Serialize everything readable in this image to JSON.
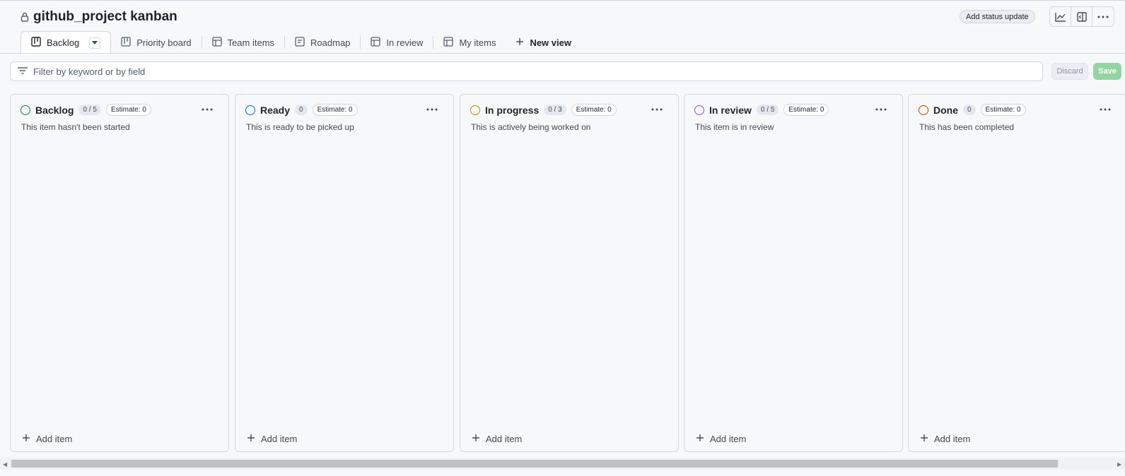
{
  "project": {
    "title": "github_project kanban"
  },
  "header": {
    "status_update_label": "Add status update"
  },
  "tabs": [
    {
      "label": "Backlog",
      "icon": "board-icon",
      "active": true
    },
    {
      "label": "Priority board",
      "icon": "board-icon"
    },
    {
      "label": "Team items",
      "icon": "table-icon"
    },
    {
      "label": "Roadmap",
      "icon": "roadmap-icon"
    },
    {
      "label": "In review",
      "icon": "table-icon"
    },
    {
      "label": "My items",
      "icon": "table-icon"
    }
  ],
  "new_view_label": "New view",
  "filter": {
    "placeholder": "Filter by keyword or by field"
  },
  "actions": {
    "discard_label": "Discard",
    "save_label": "Save"
  },
  "columns": [
    {
      "name": "Backlog",
      "count": "0 / 5",
      "estimate": "Estimate: 0",
      "description": "This item hasn't been started",
      "color": "#1a7f37",
      "add_label": "Add item"
    },
    {
      "name": "Ready",
      "count": "0",
      "estimate": "Estimate: 0",
      "description": "This is ready to be picked up",
      "color": "#0969da",
      "add_label": "Add item"
    },
    {
      "name": "In progress",
      "count": "0 / 3",
      "estimate": "Estimate: 0",
      "description": "This is actively being worked on",
      "color": "#bf8700",
      "add_label": "Add item"
    },
    {
      "name": "In review",
      "count": "0 / 5",
      "estimate": "Estimate: 0",
      "description": "This item is in review",
      "color": "#8250df",
      "add_label": "Add item"
    },
    {
      "name": "Done",
      "count": "0",
      "estimate": "Estimate: 0",
      "description": "This has been completed",
      "color": "#bc4c00",
      "add_label": "Add item"
    }
  ]
}
